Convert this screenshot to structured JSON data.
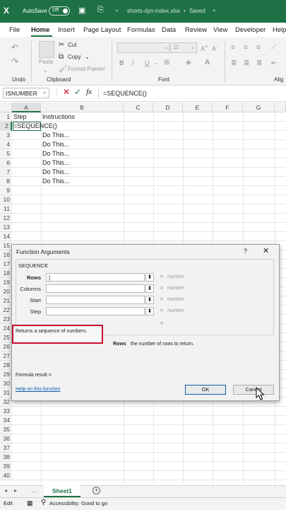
{
  "titlebar": {
    "autosave_label": "AutoSave",
    "autosave_state": "Off",
    "filename": "shorts-dyn-index.xlsx",
    "saved_status": "Saved"
  },
  "menu": [
    "File",
    "Home",
    "Insert",
    "Page Layout",
    "Formulas",
    "Data",
    "Review",
    "View",
    "Developer",
    "Help"
  ],
  "ribbon": {
    "undo_label": "Undo",
    "paste_label": "Paste",
    "cut_label": "Cut",
    "copy_label": "Copy",
    "format_painter_label": "Format Painter",
    "clipboard_label": "Clipboard",
    "font_size": "11",
    "font_label": "Font",
    "bold": "B",
    "italic": "I",
    "underline": "U",
    "align_label": "Alig"
  },
  "formula_bar": {
    "name_box": "ISNUMBER",
    "fx": "fx",
    "formula": "=SEQUENCE()"
  },
  "columns": [
    "A",
    "B",
    "C",
    "D",
    "E",
    "F",
    "G"
  ],
  "rows": [
    "1",
    "2",
    "3",
    "4",
    "5",
    "6",
    "7",
    "8",
    "9",
    "10",
    "11",
    "12",
    "13",
    "14",
    "15",
    "16",
    "17",
    "18",
    "19",
    "20",
    "21",
    "22",
    "23",
    "24",
    "25",
    "26",
    "27",
    "28",
    "29",
    "30",
    "31",
    "32",
    "33",
    "34",
    "35",
    "36",
    "37",
    "38",
    "39",
    "40"
  ],
  "cells": {
    "A1": "Step",
    "B1": "Instructions",
    "A2": "=SEQUENCE()",
    "B3": "Do This...",
    "B4": "Do This...",
    "B5": "Do This...",
    "B6": "Do This...",
    "B7": "Do This...",
    "B8": "Do This..."
  },
  "dialog": {
    "title": "Function Arguments",
    "help": "?",
    "function_name": "SEQUENCE",
    "args": [
      {
        "label": "Rows",
        "value": "number"
      },
      {
        "label": "Columns",
        "value": "number"
      },
      {
        "label": "Start",
        "value": "number"
      },
      {
        "label": "Step",
        "value": "number"
      }
    ],
    "eq": "=",
    "description": "Returns a sequence of numbers.",
    "arg_help_name": "Rows",
    "arg_help_text": "the number of rows to return.",
    "formula_result": "Formula result =",
    "help_link": "Help on this function",
    "ok": "OK",
    "cancel": "Cancel"
  },
  "sheets": {
    "active": "Sheet1",
    "add": "+"
  },
  "status": {
    "mode": "Edit",
    "accessibility": "Accessibility: Good to go"
  },
  "colors": {
    "excel_green": "#1e7145",
    "highlight_red": "#c8102e",
    "link_blue": "#0b5cad"
  }
}
